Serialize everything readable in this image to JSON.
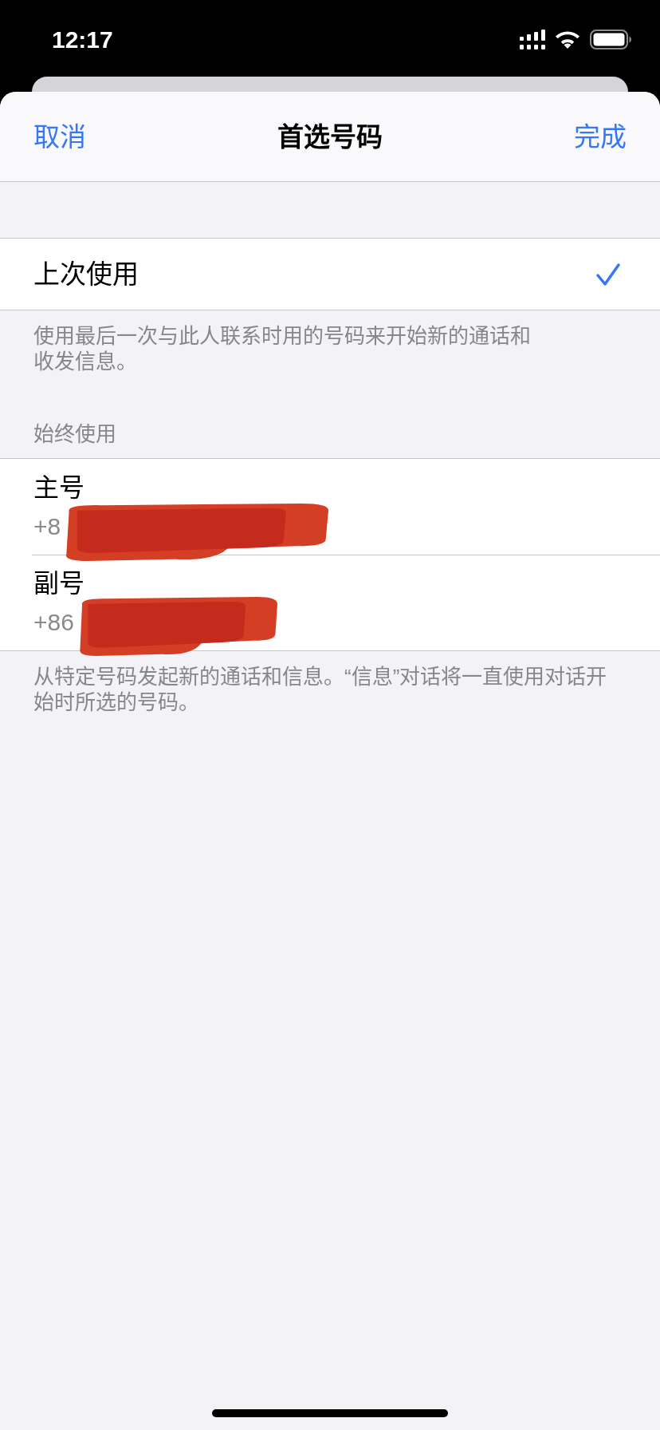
{
  "status_bar": {
    "time": "12:17"
  },
  "nav_bar": {
    "cancel": "取消",
    "title": "首选号码",
    "done": "完成"
  },
  "sections": [
    {
      "rows": [
        {
          "kind": "option",
          "label": "上次使用",
          "selected": true
        }
      ],
      "footer": "使用最后一次与此人联系时用的号码来开始新的通话和收发信息。"
    },
    {
      "header": "始终使用",
      "rows": [
        {
          "kind": "number",
          "label": "主号",
          "number": "+8",
          "selected": false,
          "redacted": true
        },
        {
          "kind": "number",
          "label": "副号",
          "number": "+86",
          "selected": false,
          "redacted": true
        }
      ],
      "footer": "从特定号码发起新的通话和信息。“信息”对话将一直使用对话开始时所选的号码。"
    }
  ]
}
